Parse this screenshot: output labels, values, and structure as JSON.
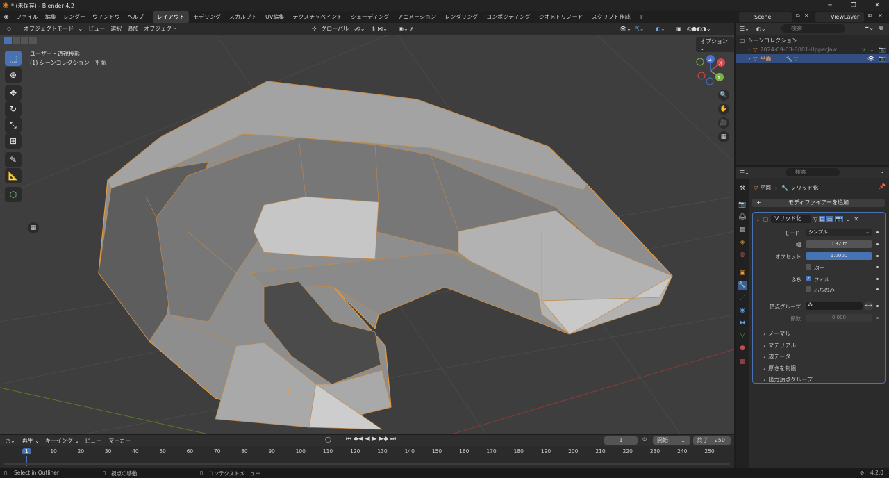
{
  "window": {
    "title": "* (未保存) - Blender 4.2",
    "min": "─",
    "max": "❐",
    "close": "✕"
  },
  "menu": [
    "ファイル",
    "編集",
    "レンダー",
    "ウィンドウ",
    "ヘルプ"
  ],
  "workspaces": [
    "レイアウト",
    "モデリング",
    "スカルプト",
    "UV編集",
    "テクスチャペイント",
    "シェーディング",
    "アニメーション",
    "レンダリング",
    "コンポジティング",
    "ジオメトリノード",
    "スクリプト作成"
  ],
  "workspace_add": "+",
  "scene": "Scene",
  "view_layer": "ViewLayer",
  "viewport": {
    "mode": "オブジェクトモード",
    "menu": [
      "ビュー",
      "選択",
      "追加",
      "オブジェクト"
    ],
    "orientation": "グローバル",
    "options": "オプション",
    "view_name": "ユーザー・透視投影",
    "collection_info": "(1) シーンコレクション | 平面",
    "gizmo": {
      "x": "X",
      "y": "Y",
      "z": "Z"
    }
  },
  "outliner": {
    "search_placeholder": "検索",
    "root": "シーンコレクション",
    "items": [
      {
        "name": "2024-09-03-0001-UpperJaw",
        "selected": false
      },
      {
        "name": "平面",
        "selected": true
      }
    ]
  },
  "properties": {
    "search_placeholder": "検索",
    "breadcrumb_object": "平面",
    "breadcrumb_modifier": "ソリッド化",
    "add_modifier": "モディファイアーを追加",
    "modifier_name": "ソリッド化",
    "mode_label": "モード",
    "mode_value": "シンプル",
    "width_label": "幅",
    "width_value": "0.32 m",
    "offset_label": "オフセット",
    "offset_value": "1.0000",
    "offset_fill": 1.0,
    "even_label": "均一",
    "rim_label": "ふち",
    "fill_label": "フィル",
    "rim_only_label": "ふちのみ",
    "vgroup_label": "頂点グループ",
    "factor_label": "係数",
    "factor_value": "0.000",
    "panels": [
      "ノーマル",
      "マテリアル",
      "辺データ",
      "厚さを制限",
      "出力頂点グループ"
    ]
  },
  "timeline": {
    "playback": "再生",
    "keying": "キーイング",
    "view": "ビュー",
    "marker": "マーカー",
    "current_frame": "1",
    "start_label": "開始",
    "start_value": "1",
    "end_label": "終了",
    "end_value": "250",
    "ticks": [
      "1",
      "10",
      "20",
      "30",
      "40",
      "50",
      "60",
      "70",
      "80",
      "90",
      "100",
      "110",
      "120",
      "130",
      "140",
      "150",
      "160",
      "170",
      "180",
      "190",
      "200",
      "210",
      "220",
      "230",
      "240",
      "250"
    ]
  },
  "status": {
    "left": "Select in Outliner",
    "middle": "視点の移動",
    "right": "コンテクストメニュー",
    "version": "4.2.0"
  },
  "colors": {
    "accent": "#4772b3",
    "selection": "#e89a3c",
    "mesh": "#9a9a9a"
  }
}
